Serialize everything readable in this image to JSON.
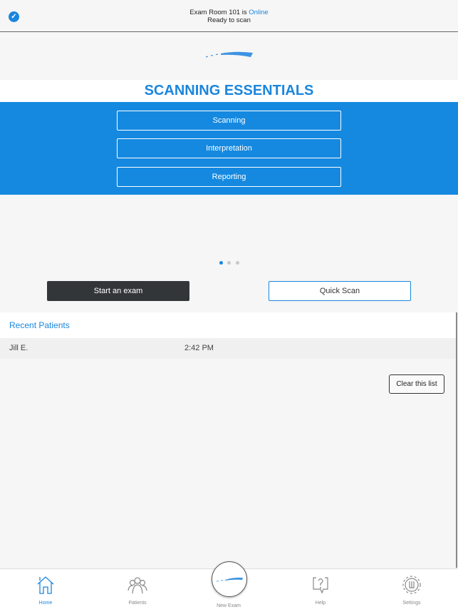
{
  "header": {
    "status_prefix": "Exam Room 101 is ",
    "status_value": "Online",
    "subtitle": "Ready to scan",
    "icon": "check-circle-icon"
  },
  "colors": {
    "accent": "#1a86dd",
    "banner": "#1589e0",
    "dark_button": "#333639"
  },
  "essentials": {
    "title": "SCANNING ESSENTIALS",
    "buttons": [
      "Scanning",
      "Interpretation",
      "Reporting"
    ]
  },
  "carousel": {
    "pages": 3,
    "active": 1
  },
  "actions": {
    "start": "Start an exam",
    "quick": "Quick Scan"
  },
  "recent": {
    "title": "Recent Patients",
    "rows": [
      {
        "name": "Jill E.",
        "time": "2:42 PM"
      }
    ],
    "clear": "Clear this list"
  },
  "tabs": [
    {
      "label": "Home",
      "active": true
    },
    {
      "label": "Patients"
    },
    {
      "label": "New Exam"
    },
    {
      "label": "Help"
    },
    {
      "label": "Settings"
    }
  ]
}
